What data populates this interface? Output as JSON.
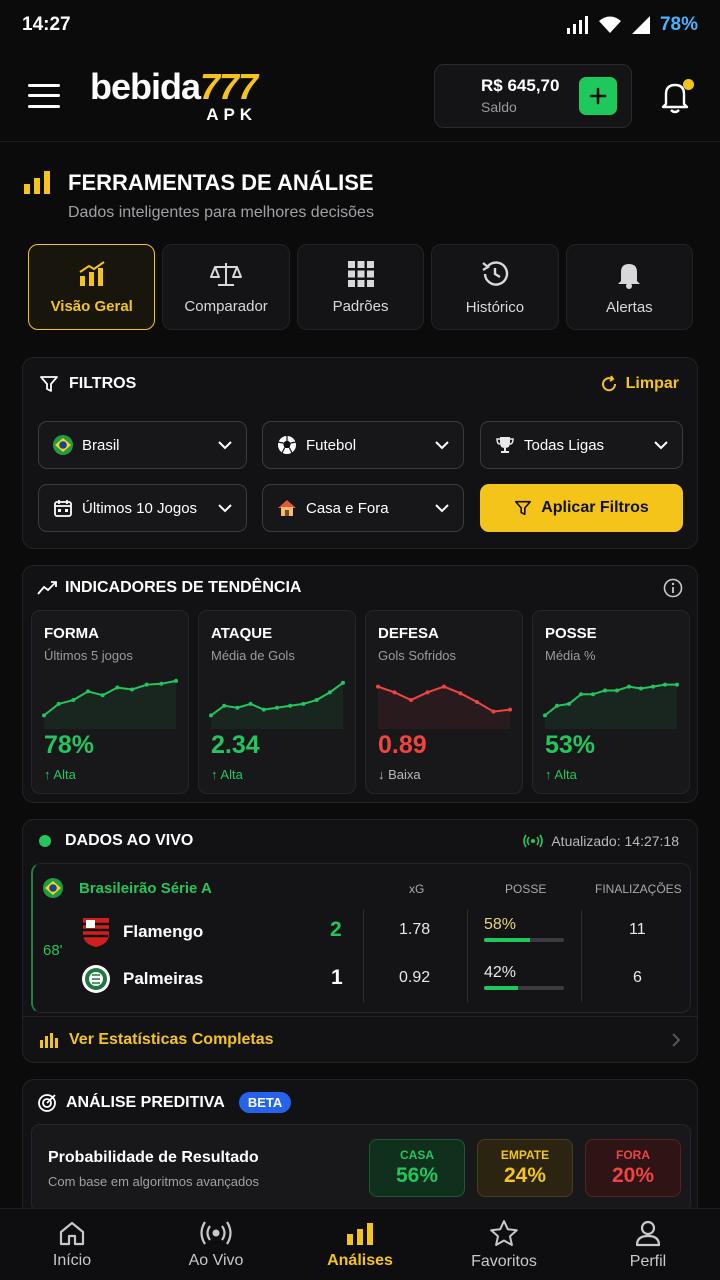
{
  "status_bar": {
    "time": "14:27",
    "battery": "78%"
  },
  "header": {
    "logo_main": "bebida",
    "logo_num": "777",
    "logo_sub": "APK",
    "balance_amount": "R$ 645,70",
    "balance_label": "Saldo"
  },
  "section": {
    "title": "FERRAMENTAS DE ANÁLISE",
    "subtitle": "Dados inteligentes para melhores decisões"
  },
  "tabs": [
    {
      "label": "Visão Geral",
      "icon": "bar-chart-trend-icon",
      "active": true
    },
    {
      "label": "Comparador",
      "icon": "scale-icon"
    },
    {
      "label": "Padrões",
      "icon": "grid-icon"
    },
    {
      "label": "Histórico",
      "icon": "history-icon"
    },
    {
      "label": "Alertas",
      "icon": "bell-icon"
    }
  ],
  "filters": {
    "title": "FILTROS",
    "clear_label": "Limpar",
    "country": "Brasil",
    "sport": "Futebol",
    "league": "Todas Ligas",
    "period": "Últimos 10 Jogos",
    "venue": "Casa e Fora",
    "apply_label": "Aplicar Filtros"
  },
  "trend": {
    "title": "INDICADORES DE TENDÊNCIA",
    "metrics": [
      {
        "title": "FORMA",
        "subtitle": "Últimos 5 jogos",
        "value": "78%",
        "trend": "↑ Alta",
        "color": "#22c55e",
        "spark": [
          10,
          22,
          26,
          35,
          31,
          39,
          37,
          42,
          43,
          46
        ]
      },
      {
        "title": "ATAQUE",
        "subtitle": "Média de Gols",
        "value": "2.34",
        "trend": "↑ Alta",
        "color": "#22c55e",
        "spark": [
          10,
          20,
          18,
          22,
          16,
          18,
          20,
          22,
          26,
          34,
          44
        ]
      },
      {
        "title": "DEFESA",
        "subtitle": "Gols Sofridos",
        "value": "0.89",
        "trend": "↓ Baixa",
        "color": "#ef4444",
        "spark": [
          40,
          34,
          26,
          34,
          40,
          33,
          24,
          14,
          16
        ]
      },
      {
        "title": "POSSE",
        "subtitle": "Média %",
        "value": "53%",
        "trend": "↑ Alta",
        "color": "#22c55e",
        "spark": [
          10,
          20,
          22,
          32,
          32,
          36,
          36,
          40,
          38,
          40,
          42,
          42
        ]
      }
    ]
  },
  "live": {
    "title": "DADOS AO VIVO",
    "updated": "Atualizado: 14:27:18",
    "league": "Brasileirão Série A",
    "col_xg": "xG",
    "col_posse": "POSSE",
    "col_fin": "FINALIZAÇÕES",
    "minute": "68'",
    "home": {
      "name": "Flamengo",
      "score": "2",
      "xg": "1.78",
      "posse": "58%",
      "posse_pct": 58,
      "fin": "11"
    },
    "away": {
      "name": "Palmeiras",
      "score": "1",
      "xg": "0.92",
      "posse": "42%",
      "posse_pct": 42,
      "fin": "6"
    },
    "full_stats": "Ver Estatísticas Completas"
  },
  "predictive": {
    "title": "ANÁLISE PREDITIVA",
    "badge": "BETA",
    "box_title": "Probabilidade de Resultado",
    "box_sub": "Com base em algoritmos avançados",
    "home_label": "CASA",
    "home_value": "56%",
    "draw_label": "EMPATE",
    "draw_value": "24%",
    "away_label": "FORA",
    "away_value": "20%"
  },
  "nav": [
    {
      "label": "Início",
      "icon": "home-icon"
    },
    {
      "label": "Ao Vivo",
      "icon": "live-signal-icon"
    },
    {
      "label": "Análises",
      "icon": "analytics-icon",
      "active": true
    },
    {
      "label": "Favoritos",
      "icon": "star-icon"
    },
    {
      "label": "Perfil",
      "icon": "user-icon"
    }
  ]
}
